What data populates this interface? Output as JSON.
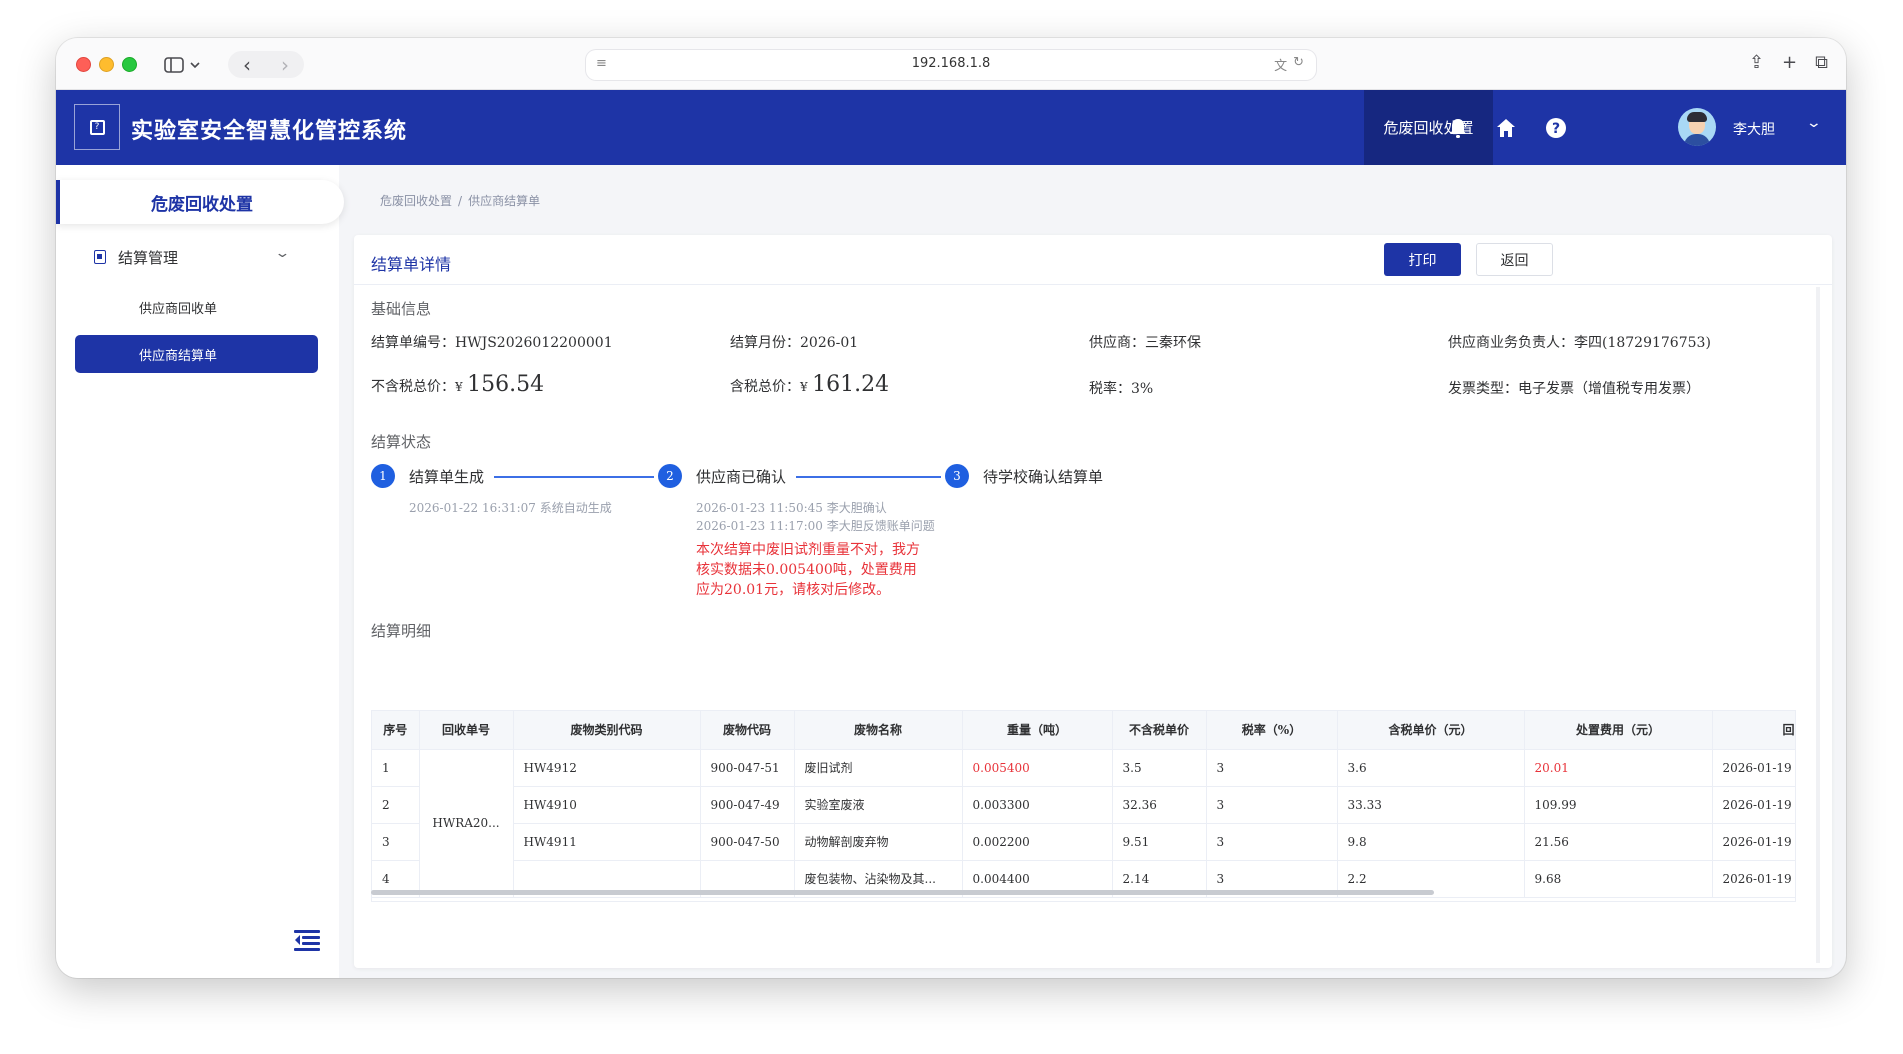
{
  "browser": {
    "url": "192.168.1.8"
  },
  "app": {
    "title": "实验室安全智慧化管控系统",
    "module_tab": "危废回收处置",
    "user_name": "李大胆"
  },
  "sidebar": {
    "module_title": "危废回收处置",
    "group_label": "结算管理",
    "items": [
      {
        "label": "供应商回收单",
        "active": false
      },
      {
        "label": "供应商结算单",
        "active": true
      }
    ]
  },
  "breadcrumb": {
    "root": "危废回收处置",
    "separator": "/",
    "current": "供应商结算单"
  },
  "detail": {
    "title": "结算单详情",
    "print_label": "打印",
    "back_label": "返回",
    "basic_title": "基础信息",
    "fields": {
      "order_no": "结算单编号：HWJS2026012200001",
      "month": "结算月份：2026-01",
      "supplier": "供应商：三秦环保",
      "supplier_contact": "供应商业务负责人：李四(18729176753)",
      "pretax_label": "不含税总价：",
      "pretax_yen": "¥",
      "pretax_amount": "156.54",
      "tax_total_label": "含税总价：",
      "tax_total_yen": "¥",
      "tax_total_amount": "161.24",
      "tax_rate": "税率：3%",
      "invoice_type": "发票类型：电子发票（增值税专用发票）"
    },
    "status_title": "结算状态",
    "steps": [
      {
        "num": "1",
        "label": "结算单生成",
        "meta": [
          "2026-01-22 16:31:07 系统自动生成"
        ]
      },
      {
        "num": "2",
        "label": "供应商已确认",
        "meta": [
          "2026-01-23 11:50:45 李大胆确认",
          "2026-01-23 11:17:00 李大胆反馈账单问题"
        ],
        "warning": "本次结算中废旧试剂重量不对，我方核实数据未0.005400吨，处置费用应为20.01元，请核对后修改。"
      },
      {
        "num": "3",
        "label": "待学校确认结算单",
        "meta": []
      }
    ],
    "detail_title": "结算明细"
  },
  "table": {
    "headers": [
      "序号",
      "回收单号",
      "废物类别代码",
      "废物代码",
      "废物名称",
      "重量（吨）",
      "不含税单价",
      "税率（%）",
      "含税单价（元）",
      "处置费用（元）",
      "回"
    ],
    "merged_recovery_no": "HWRA20...",
    "rows": [
      {
        "idx": "1",
        "category": "HW4912",
        "code": "900-047-51",
        "name": "废旧试剂",
        "weight": "0.005400",
        "unit_price": "3.5",
        "tax": "3",
        "tax_price": "3.6",
        "fee": "20.01",
        "date": "2026-01-19"
      },
      {
        "idx": "2",
        "category": "HW4910",
        "code": "900-047-49",
        "name": "实验室废液",
        "weight": "0.003300",
        "unit_price": "32.36",
        "tax": "3",
        "tax_price": "33.33",
        "fee": "109.99",
        "date": "2026-01-19"
      },
      {
        "idx": "3",
        "category": "HW4911",
        "code": "900-047-50",
        "name": "动物解剖废弃物",
        "weight": "0.002200",
        "unit_price": "9.51",
        "tax": "3",
        "tax_price": "9.8",
        "fee": "21.56",
        "date": "2026-01-19"
      },
      {
        "idx": "4",
        "category": "",
        "code": "",
        "name": "废包装物、沾染物及其...",
        "weight": "0.004400",
        "unit_price": "2.14",
        "tax": "3",
        "tax_price": "2.2",
        "fee": "9.68",
        "date": "2026-01-19"
      }
    ]
  },
  "colors": {
    "primary": "#1e34a6",
    "step_blue": "#1f5fe0",
    "warning_red": "#e8333a"
  },
  "icons": [
    "sidebar-toggle-icon",
    "back-icon",
    "forward-icon",
    "reader-icon",
    "translate-icon",
    "reload-icon",
    "share-icon",
    "new-tab-icon",
    "tabs-icon",
    "bell-icon",
    "home-icon",
    "help-icon",
    "chevron-down-icon",
    "menu-collapse-icon"
  ]
}
